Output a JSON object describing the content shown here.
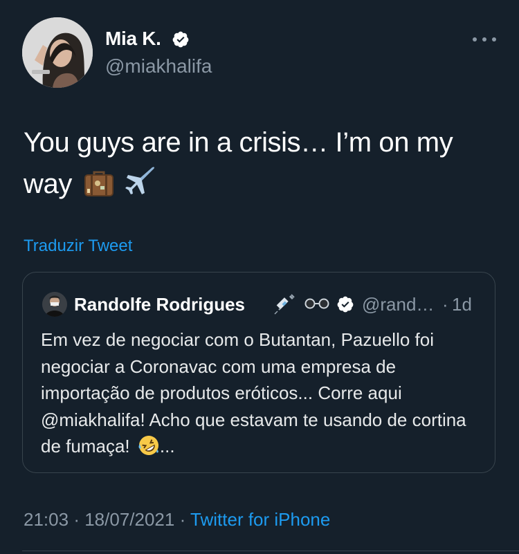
{
  "tweet": {
    "author": {
      "name": "Mia K.",
      "handle": "@miakhalifa",
      "verified": true
    },
    "text": "You guys are in a crisis… I’m on my way",
    "emojis": [
      "luggage-emoji",
      "airplane-emoji"
    ],
    "translate_label": "Traduzir Tweet",
    "time": "21:03",
    "separator": "·",
    "date": "18/07/2021",
    "source": "Twitter for iPhone"
  },
  "quote": {
    "author_name": "Randolfe Rodrigues",
    "name_emojis": [
      "syringe-emoji",
      "glasses-emoji"
    ],
    "verified": true,
    "handle": "@rand…",
    "separator": "·",
    "time": "1d",
    "text": "Em vez de negociar com o Butantan, Pazuello foi negociar a Coronavac com uma empresa de importação de produtos eróticos... Corre aqui @miakhalifa! Acho que estavam te usando de cortina de fumaça!",
    "text_suffix": "...",
    "emoji": "rolling-on-floor-laughing-emoji"
  },
  "colors": {
    "background": "#15202b",
    "text": "#ffffff",
    "secondary": "#8b98a5",
    "link": "#1d9bf0",
    "border": "#38444d"
  }
}
